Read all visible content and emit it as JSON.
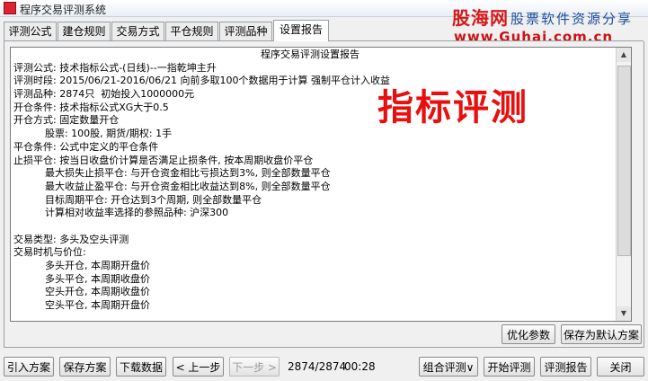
{
  "window": {
    "title": "程序交易评测系统"
  },
  "watermark": {
    "logo_cn_part1": "股",
    "logo_cn_part2": "海网",
    "slogan": "股票软件资源分享",
    "url": "www.Guhai.com.cn"
  },
  "tabs": [
    {
      "label": "评测公式"
    },
    {
      "label": "建仓规则"
    },
    {
      "label": "交易方式"
    },
    {
      "label": "平仓规则"
    },
    {
      "label": "评测品种"
    },
    {
      "label": "设置报告"
    }
  ],
  "report": {
    "title": "程序交易评测设置报告",
    "lines": [
      "评测公式: 技术指标公式-(日线)--一指乾坤主升",
      "评测时段: 2015/06/21-2016/06/21 向前多取100个数据用于计算 强制平仓计入收益",
      "评测品种: 2874只  初始投入1000000元",
      "开仓条件: 技术指标公式XG大于0.5",
      "开仓方式: 固定数量开仓",
      "          股票: 100股, 期货/期权: 1手",
      "平仓条件: 公式中定义的平仓条件",
      "止损平仓: 按当日收盘价计算是否满足止损条件, 按本周期收盘价平仓",
      "          最大损失止损平仓: 与开仓资金相比亏损达到3%, 则全部数量平仓",
      "          最大收益止盈平仓: 与开仓资金相比收益达到8%, 则全部数量平仓",
      "          目标周期平仓: 开仓达到3个周期, 则全部数量平仓",
      "          计算相对收益率选择的参照品种: 沪深300",
      "",
      "交易类型: 多头及空头评测",
      "交易时机与价位:",
      "          多头开仓, 本周期开盘价",
      "          多头平仓, 本周期收盘价",
      "          空头开仓, 本周期收盘价",
      "          空头平仓, 本周期开盘价"
    ],
    "overlay_text": "指标评测"
  },
  "panel_buttons": {
    "optimize": "优化参数",
    "save_default": "保存为默认方案"
  },
  "bottom": {
    "import": "引入方案",
    "save": "保存方案",
    "download": "下载数据",
    "prev": "< 上一步",
    "next": "下一步 >",
    "progress": "2874/2874",
    "elapsed": "00:28",
    "combo": "组合评测",
    "start": "开始评测",
    "report": "评测报告",
    "close": "关闭"
  }
}
